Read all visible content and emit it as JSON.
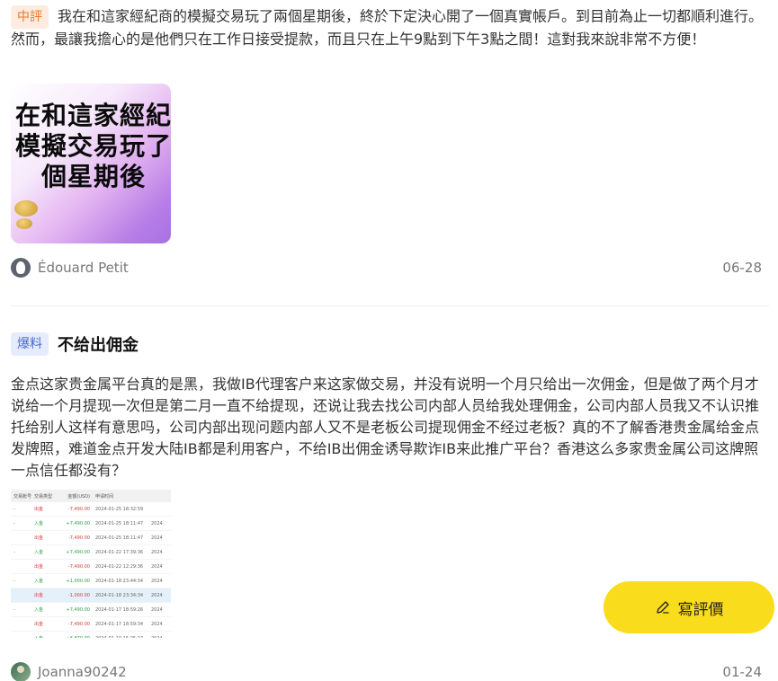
{
  "review1": {
    "badge": "中評",
    "text": "我在和這家經紀商的模擬交易玩了兩個星期後，終於下定決心開了一個真實帳戶。到目前為止一切都順利進行。然而，最讓我擔心的是他們只在工作日接受提款，而且只在上午9點到下午3點之間！這對我來說非常不方便！",
    "image_text": [
      "在和這家經紀",
      "模擬交易玩了",
      "個星期後"
    ],
    "author": "Édouard Petit",
    "date": "06-28"
  },
  "review2": {
    "badge": "爆料",
    "title": "不给出佣金",
    "text": "金点这家贵金属平台真的是黑，我做IB代理客户来这家做交易，并没有说明一个月只给出一次佣金，但是做了两个月才说给一个月提现一次但是第二月一直不给提现，还说让我去找公司内部人员给我处理佣金，公司内部人员我又不认识推托给别人这样有意思吗，公司内部出现问题内部人又不是老板公司提现佣金不经过老板？真的不了解香港贵金属给金点发牌照，难道金点开发大陆IB都是利用客户，不给IB出佣金诱导欺诈IB来此推广平台？香港这么多家贵金属公司这牌照一点信任都没有？",
    "table": {
      "headers": [
        "交易账号",
        "交易类型",
        "金额(USD)",
        "申请时间",
        ""
      ],
      "rows": [
        {
          "c1": "-",
          "c2": "出金",
          "c2c": "red",
          "c3": "-7,490.00",
          "c3c": "red",
          "c4": "2024-01-25 18:32:59",
          "c5": "",
          "hl": false
        },
        {
          "c1": "-",
          "c2": "入金",
          "c2c": "green",
          "c3": "+7,490.00",
          "c3c": "green",
          "c4": "2024-01-25 18:11:47",
          "c5": "2024",
          "hl": false
        },
        {
          "c1": "",
          "c2": "出金",
          "c2c": "red",
          "c3": "-7,490.00",
          "c3c": "red",
          "c4": "2024-01-25 18:11:47",
          "c5": "2024",
          "hl": false
        },
        {
          "c1": "-",
          "c2": "入金",
          "c2c": "green",
          "c3": "+7,490.00",
          "c3c": "green",
          "c4": "2024-01-22 17:39:36",
          "c5": "2024",
          "hl": false
        },
        {
          "c1": "",
          "c2": "出金",
          "c2c": "red",
          "c3": "-7,490.00",
          "c3c": "red",
          "c4": "2024-01-22 12:29:36",
          "c5": "2024",
          "hl": false
        },
        {
          "c1": "-",
          "c2": "入金",
          "c2c": "green",
          "c3": "+1,000.00",
          "c3c": "green",
          "c4": "2024-01-18 23:44:54",
          "c5": "2024",
          "hl": false
        },
        {
          "c1": "",
          "c2": "出金",
          "c2c": "red",
          "c3": "-1,000.00",
          "c3c": "red",
          "c4": "2024-01-18 23:34:34",
          "c5": "2024",
          "hl": true
        },
        {
          "c1": "-",
          "c2": "入金",
          "c2c": "green",
          "c3": "+7,490.00",
          "c3c": "green",
          "c4": "2024-01-17 18:59:26",
          "c5": "2024",
          "hl": false
        },
        {
          "c1": "",
          "c2": "出金",
          "c2c": "red",
          "c3": "-7,490.00",
          "c3c": "red",
          "c4": "2024-01-17 18:59:34",
          "c5": "2024",
          "hl": false
        },
        {
          "c1": "-",
          "c2": "入金",
          "c2c": "green",
          "c3": "+6,870.00",
          "c3c": "green",
          "c4": "2024-01-10 15:25:17",
          "c5": "2024",
          "hl": false
        }
      ]
    },
    "author": "Joanna90242",
    "date": "01-24"
  },
  "write_button": {
    "label": "寫評價",
    "icon": "pen-icon"
  },
  "colors": {
    "button_bg": "#f9dc1c",
    "badge_mid": "#e8792b",
    "badge_leak": "#4a6bd6"
  }
}
